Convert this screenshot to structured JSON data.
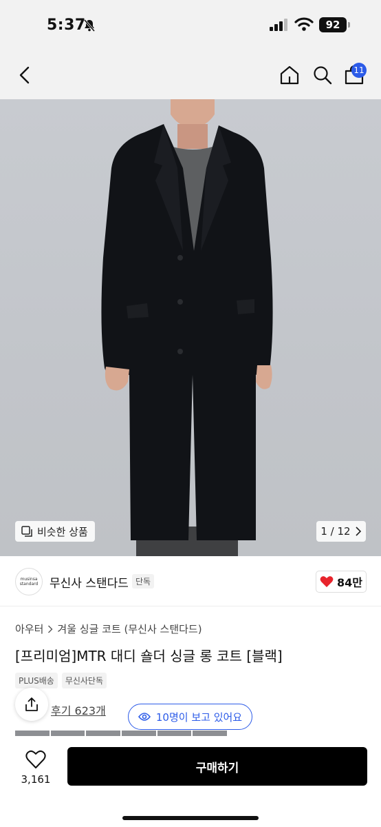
{
  "status_bar": {
    "time": "5:37",
    "battery": "92"
  },
  "nav": {
    "cart_count": "11"
  },
  "hero": {
    "similar_label": "비슷한 상품",
    "pager": "1 / 12"
  },
  "brand": {
    "logo_line1": "musinsa",
    "logo_line2": "standard",
    "name": "무신사 스탠다드",
    "exclusive_tag": "단독",
    "likes": "84만"
  },
  "product": {
    "breadcrumb": [
      "아우터",
      "겨울 싱글 코트 (무신사 스탠다드)"
    ],
    "title": "[프리미엄]MTR 대디 숄더 싱글 롱 코트 [블랙]",
    "tags": [
      "PLUS배송",
      "무신사단독"
    ],
    "reviews": "후기 623개",
    "viewers": "10명이 보고 있어요"
  },
  "bottom_bar": {
    "favorite_count": "3,161",
    "buy_label": "구매하기"
  },
  "colors": {
    "accent": "#2c5be8",
    "heart": "#e8242c",
    "buy_button": "#000000"
  }
}
